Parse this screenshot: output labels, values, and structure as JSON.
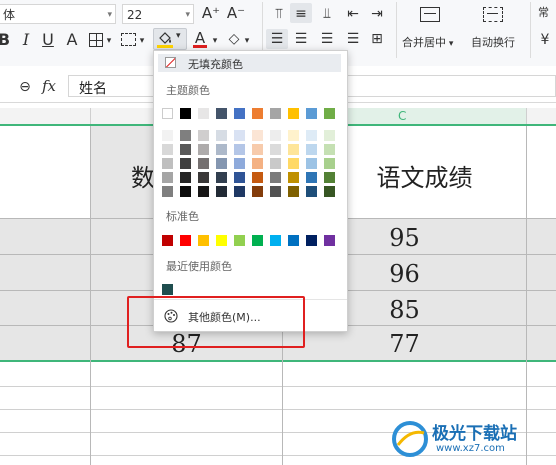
{
  "toolbar": {
    "font_name": "体",
    "font_size": "22",
    "grow_font": "A⁺",
    "shrink_font": "A⁻",
    "bold": "B",
    "italic": "I",
    "underline": "U",
    "strike": "A",
    "merge_center": "合并居中",
    "wrap_text": "自动换行",
    "cut_label": "常"
  },
  "formula_bar": {
    "fx": "fx",
    "value": "姓名"
  },
  "columns": {
    "c": "C"
  },
  "cells": {
    "header_partial": "数",
    "header_c": "语文成绩",
    "row_values": [
      "95",
      "96",
      "85",
      "77"
    ],
    "row_b_last": "87"
  },
  "fill_menu": {
    "no_fill": "无填充颜色",
    "theme_colors_label": "主题颜色",
    "standard_colors_label": "标准色",
    "recent_colors_label": "最近使用颜色",
    "more_colors": "其他颜色(M)...",
    "theme_top": [
      "#ffffff",
      "#000000",
      "#e7e6e6",
      "#44546a",
      "#4472c4",
      "#ed7d31",
      "#a5a5a5",
      "#ffc000",
      "#5b9bd5",
      "#70ad47"
    ],
    "theme_shades": [
      [
        "#f2f2f2",
        "#7f7f7f",
        "#d0cece",
        "#d6dce4",
        "#d9e2f3",
        "#fbe5d5",
        "#ededed",
        "#fff2cc",
        "#deebf6",
        "#e2efd9"
      ],
      [
        "#d8d8d8",
        "#595959",
        "#aeabab",
        "#adb9ca",
        "#b4c6e7",
        "#f7cbac",
        "#dbdbdb",
        "#fee599",
        "#bdd7ee",
        "#c5e0b3"
      ],
      [
        "#bfbfbf",
        "#3f3f3f",
        "#757070",
        "#8496b0",
        "#8eaadb",
        "#f4b183",
        "#c9c9c9",
        "#ffd965",
        "#9cc3e5",
        "#a8d08d"
      ],
      [
        "#a5a5a5",
        "#262626",
        "#3a3838",
        "#323f4f",
        "#2f5496",
        "#c55a11",
        "#7b7b7b",
        "#bf9000",
        "#2e75b5",
        "#538135"
      ],
      [
        "#7f7f7f",
        "#0c0c0c",
        "#171616",
        "#222a35",
        "#1f3864",
        "#833c0b",
        "#525252",
        "#7f6000",
        "#1e4e79",
        "#375623"
      ]
    ],
    "standard": [
      "#c00000",
      "#ff0000",
      "#ffc000",
      "#ffff00",
      "#92d050",
      "#00b050",
      "#00b0f0",
      "#0070c0",
      "#002060",
      "#7030a0"
    ],
    "recent": [
      "#1f4e4f"
    ]
  },
  "watermark": {
    "text": "极光下载站",
    "url": "www.xz7.com"
  },
  "colors": {
    "accent_green": "#3fb67a",
    "highlight_red": "#e02020"
  }
}
